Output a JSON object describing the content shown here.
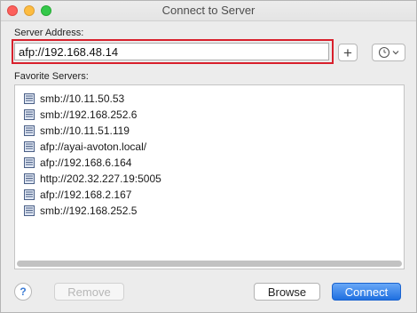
{
  "window": {
    "title": "Connect to Server"
  },
  "server_address": {
    "label": "Server Address:",
    "value": "afp://192.168.48.14"
  },
  "favorites": {
    "label": "Favorite Servers:",
    "items": [
      {
        "address": "smb://10.11.50.53"
      },
      {
        "address": "smb://192.168.252.6"
      },
      {
        "address": "smb://10.11.51.119"
      },
      {
        "address": "afp://ayai-avoton.local/"
      },
      {
        "address": "afp://192.168.6.164"
      },
      {
        "address": "http://202.32.227.19:5005"
      },
      {
        "address": "afp://192.168.2.167"
      },
      {
        "address": "smb://192.168.252.5"
      }
    ]
  },
  "buttons": {
    "add": "+",
    "help": "?",
    "remove": "Remove",
    "browse": "Browse",
    "connect": "Connect"
  },
  "colors": {
    "highlight_box": "#d8202c",
    "connect_button": "#1f6fe0"
  }
}
